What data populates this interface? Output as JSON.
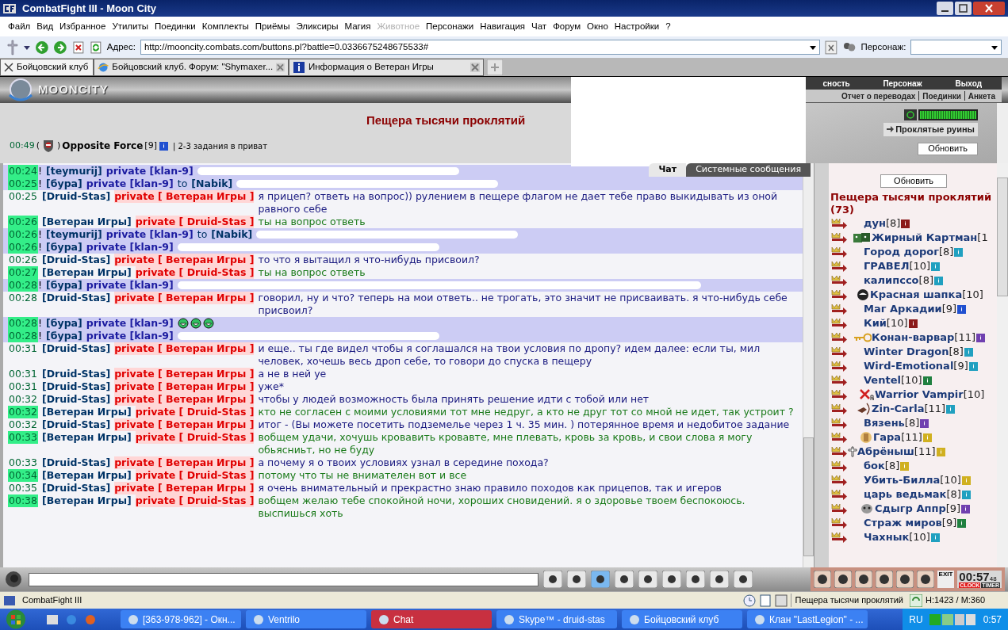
{
  "window": {
    "title": "CombatFight III - Moon City"
  },
  "menu": [
    {
      "label": "Файл",
      "disabled": false
    },
    {
      "label": "Вид",
      "disabled": false
    },
    {
      "label": "Избранное",
      "disabled": false
    },
    {
      "label": "Утилиты",
      "disabled": false
    },
    {
      "label": "Поединки",
      "disabled": false
    },
    {
      "label": "Комплекты",
      "disabled": false
    },
    {
      "label": "Приёмы",
      "disabled": false
    },
    {
      "label": "Эликсиры",
      "disabled": false
    },
    {
      "label": "Магия",
      "disabled": false
    },
    {
      "label": "Животное",
      "disabled": true
    },
    {
      "label": "Персонажи",
      "disabled": false
    },
    {
      "label": "Навигация",
      "disabled": false
    },
    {
      "label": "Чат",
      "disabled": false
    },
    {
      "label": "Форум",
      "disabled": false
    },
    {
      "label": "Окно",
      "disabled": false
    },
    {
      "label": "Настройки",
      "disabled": false
    },
    {
      "label": "?",
      "disabled": false
    }
  ],
  "toolbar": {
    "address_label": "Адрес:",
    "address": "http://mooncity.combats.com/buttons.pl?battle=0.0336675248675533#",
    "character_label": "Персонаж:"
  },
  "tabs": [
    {
      "label": "Бойцовский клуб",
      "selected": true
    },
    {
      "label": "Бойцовский клуб. Форум: \"Shymaxer...",
      "selected": false
    },
    {
      "label": "Информация о Ветеран Игры",
      "selected": false
    }
  ],
  "game": {
    "logo": "MOONCITY",
    "nav_top": [
      "сность",
      "Персонаж",
      "Выход"
    ],
    "nav_bottom": [
      "Отчет о переводах",
      "Поединки",
      "Анкета"
    ],
    "room_title": "Пещера тысячи проклятий",
    "location": "Проклятые руины",
    "refresh": "Обновить",
    "meter": {
      "level": 1
    }
  },
  "header_line": {
    "time": "00:49",
    "open": "(",
    "close": ")",
    "name": "Opposite Force",
    "level": "[9]",
    "note": "| 2-3 задания в приват"
  },
  "chat_tabs": [
    {
      "label": "Чат",
      "selected": true
    },
    {
      "label": "Системные сообщения",
      "selected": false
    }
  ],
  "messages": [
    {
      "time": "00:24",
      "mark": "!",
      "highlight": true,
      "kind": "redacted",
      "sender": "[teymurij]",
      "recipient": "private [klan-9]"
    },
    {
      "time": "00:25",
      "mark": "!",
      "highlight": true,
      "kind": "redacted",
      "sender": "[бура]",
      "recipient": "private [klan-9]",
      "to": "to",
      "to_name": "[Nabik]"
    },
    {
      "time": "00:25",
      "highlight": false,
      "kind": "private",
      "sender": "[Druid-Stas]",
      "recipient": "private [ Ветеран Игры ]",
      "text": "я прицеп? ответь на вопрос)) рулением в пещере флагом не дает тебе право выкидывать из оной равного себе"
    },
    {
      "time": "00:26",
      "highlight": true,
      "kind": "private",
      "sender": "[Ветеран Игры]",
      "recipient": "private [ Druid-Stas ]",
      "text": "ты на вопрос ответь"
    },
    {
      "time": "00:26",
      "mark": "!",
      "highlight": true,
      "kind": "redacted",
      "sender": "[teymurij]",
      "recipient": "private [klan-9]",
      "to": "to",
      "to_name": "[Nabik]"
    },
    {
      "time": "00:26",
      "mark": "!",
      "highlight": true,
      "kind": "redacted",
      "sender": "[бура]",
      "recipient": "private [klan-9]"
    },
    {
      "time": "00:26",
      "highlight": false,
      "kind": "private",
      "sender": "[Druid-Stas]",
      "recipient": "private [ Ветеран Игры ]",
      "text": "то что я вытащил я что-нибудь присвоил?"
    },
    {
      "time": "00:27",
      "highlight": true,
      "kind": "private",
      "sender": "[Ветеран Игры]",
      "recipient": "private [ Druid-Stas ]",
      "text": "ты на вопрос ответь"
    },
    {
      "time": "00:28",
      "mark": "!",
      "highlight": true,
      "kind": "smeared",
      "sender": "[бура]",
      "recipient": "private [klan-9]"
    },
    {
      "time": "00:28",
      "highlight": false,
      "kind": "private",
      "sender": "[Druid-Stas]",
      "recipient": "private [ Ветеран Игры ]",
      "text": "говорил, ну и что? теперь на мои ответь.. не трогать, это значит не присваивать. я что-нибудь себе присвоил?"
    },
    {
      "time": "00:28",
      "mark": "!",
      "highlight": true,
      "kind": "smileys",
      "sender": "[бура]",
      "recipient": "private [klan-9]"
    },
    {
      "time": "00:28",
      "mark": "!",
      "highlight": true,
      "kind": "redacted",
      "sender": "[бура]",
      "recipient": "private [klan-9]"
    },
    {
      "time": "00:31",
      "highlight": false,
      "kind": "private",
      "sender": "[Druid-Stas]",
      "recipient": "private [ Ветеран Игры ]",
      "text": "и еще.. ты где видел чтобы я соглашался на твои условия по дропу? идем далее: если ты, мил человек, хочешь весь дроп себе, то говори до спуска в пещеру"
    },
    {
      "time": "00:31",
      "highlight": false,
      "kind": "private",
      "sender": "[Druid-Stas]",
      "recipient": "private [ Ветеран Игры ]",
      "text": "а не в ней уе"
    },
    {
      "time": "00:31",
      "highlight": false,
      "kind": "private",
      "sender": "[Druid-Stas]",
      "recipient": "private [ Ветеран Игры ]",
      "text": "уже*"
    },
    {
      "time": "00:32",
      "highlight": false,
      "kind": "private",
      "sender": "[Druid-Stas]",
      "recipient": "private [ Ветеран Игры ]",
      "text": "чтобы у людей возможность была принять решение идти с тобой или нет"
    },
    {
      "time": "00:32",
      "highlight": true,
      "kind": "private",
      "sender": "[Ветеран Игры]",
      "recipient": "private [ Druid-Stas ]",
      "text": "кто не согласен с моими условиями тот мне недруг, а кто не друг тот со мной не идет, так устроит ?"
    },
    {
      "time": "00:32",
      "highlight": false,
      "kind": "private",
      "sender": "[Druid-Stas]",
      "recipient": "private [ Ветеран Игры ]",
      "text": "итог - (Вы можете посетить подземелье через 1 ч. 35 мин. ) потерянное время и недобитое задание"
    },
    {
      "time": "00:33",
      "highlight": true,
      "kind": "private",
      "sender": "[Ветеран Игры]",
      "recipient": "private [ Druid-Stas ]",
      "text": "вобщем удачи, хочушь кровавить кровавте, мне плевать, кровь за кровь, и свои слова я могу обьясниьт, но не буду"
    },
    {
      "time": "00:33",
      "highlight": false,
      "kind": "private",
      "sender": "[Druid-Stas]",
      "recipient": "private [ Ветеран Игры ]",
      "text": "а почему я о твоих условиях узнал в середине похода?"
    },
    {
      "time": "00:34",
      "highlight": true,
      "kind": "private",
      "sender": "[Ветеран Игры]",
      "recipient": "private [ Druid-Stas ]",
      "text": "потому что ты не внимателен вот и все"
    },
    {
      "time": "00:35",
      "highlight": false,
      "kind": "private",
      "sender": "[Druid-Stas]",
      "recipient": "private [ Ветеран Игры ]",
      "text": "я очень внимательный и прекрастно знаю правило походов как прицепов, так и игеров"
    },
    {
      "time": "00:38",
      "highlight": true,
      "kind": "private",
      "sender": "[Ветеран Игры]",
      "recipient": "private [ Druid-Stas ]",
      "text": "вобщем желаю тебе спокойной ночи, хороших сновидений. я о здоровье твоем беспокоюсь. выспишься хоть"
    }
  ],
  "online": {
    "refresh": "Обновить",
    "title": "Пещера тысячи проклятий",
    "count": "(73)",
    "players": [
      {
        "name": "дун",
        "level": "[8]",
        "color": "#8b1a1a",
        "kind": "none"
      },
      {
        "name": "Жирный Картман",
        "level": "[1",
        "kind": "dice"
      },
      {
        "name": "Город дорог",
        "level": "[8]",
        "color": "#20a0c0",
        "kind": "none"
      },
      {
        "name": "ГРАВЕЛ",
        "level": "[10]",
        "color": "#20a0c0",
        "kind": "none"
      },
      {
        "name": "калипссо",
        "level": "[8]",
        "color": "#20a0c0",
        "kind": "none"
      },
      {
        "name": "Красная шапка",
        "level": "[10]",
        "kind": "ball"
      },
      {
        "name": "Маг Аркадии",
        "level": "[9]",
        "color": "#2050d0",
        "kind": "none"
      },
      {
        "name": "Кий",
        "level": "[10]",
        "color": "#8b1a1a",
        "kind": "none"
      },
      {
        "name": "Конан-варвар",
        "level": "[11]",
        "color": "#7040b0",
        "kind": "key"
      },
      {
        "name": "Winter Dragon",
        "level": "[8]",
        "color": "#20a0c0",
        "kind": "none"
      },
      {
        "name": "Wird-Emotional",
        "level": "[9]",
        "color": "#20a0c0",
        "kind": "none"
      },
      {
        "name": "Ventel",
        "level": "[10]",
        "color": "#208040",
        "kind": "none"
      },
      {
        "name": "Warrior Vampir",
        "level": "[10]",
        "kind": "crossed"
      },
      {
        "name": "Zin-Carla",
        "level": "[11]",
        "color": "#20a0c0",
        "kind": "archer"
      },
      {
        "name": "Вязень",
        "level": "[8]",
        "color": "#7040b0",
        "kind": "none"
      },
      {
        "name": "Гара",
        "level": "[11]",
        "color": "#d0b020",
        "kind": "lamp"
      },
      {
        "name": "Абрёныш",
        "level": "[11]",
        "color": "#d0b020",
        "kind": "cross"
      },
      {
        "name": "бок",
        "level": "[8]",
        "color": "#d0b020",
        "kind": "none"
      },
      {
        "name": "Убить-Билла",
        "level": "[10]",
        "color": "#d0b020",
        "kind": "none"
      },
      {
        "name": "царь ведьмак",
        "level": "[8]",
        "color": "#20a0c0",
        "kind": "none"
      },
      {
        "name": "Сдыгр Аппр",
        "level": "[9]",
        "color": "#7040b0",
        "kind": "skull"
      },
      {
        "name": "Страж миров",
        "level": "[9]",
        "color": "#208040",
        "kind": "none"
      },
      {
        "name": "Чахнык",
        "level": "[10]",
        "color": "#20a0c0",
        "kind": "none"
      }
    ]
  },
  "clock": {
    "exit": "EXIT",
    "time": "00:57",
    "seconds": "48",
    "clock": "CLOCK",
    "timer": "TIMER"
  },
  "status_bar": {
    "app": "CombatFight III",
    "room": "Пещера тысячи проклятий",
    "stats": "H:1423 / M:360"
  },
  "taskbar": {
    "items": [
      {
        "label": "[363-978-962] - Окн...",
        "selected": false
      },
      {
        "label": "Ventrilo",
        "selected": false
      },
      {
        "label": "Chat",
        "selected": true
      },
      {
        "label": "Skype™ - druid-stas",
        "selected": false
      },
      {
        "label": "Бойцовский клуб",
        "selected": false
      },
      {
        "label": "Клан \"LastLegion\" - ...",
        "selected": false
      }
    ],
    "lang": "RU",
    "time": "0:57"
  }
}
